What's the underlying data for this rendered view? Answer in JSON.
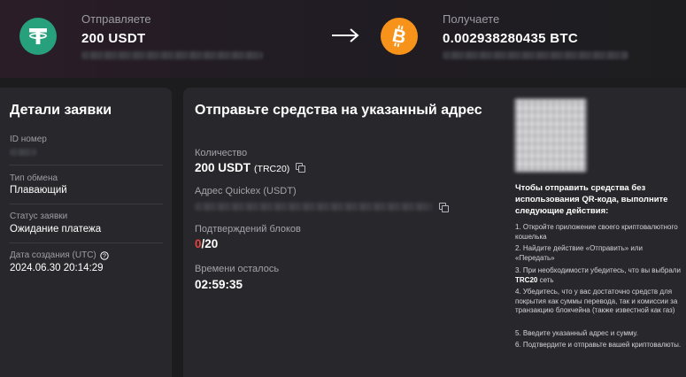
{
  "send": {
    "label": "Отправляете",
    "amount": "200  USDT",
    "coin_icon": "tether-icon",
    "color": "#26a17b"
  },
  "receive": {
    "label": "Получаете",
    "amount": "0.002938280435  BTC",
    "coin_icon": "bitcoin-icon",
    "color": "#f7931a"
  },
  "details": {
    "title": "Детали заявки",
    "fields": [
      {
        "label": "ID номер",
        "value": ""
      },
      {
        "label": "Тип обмена",
        "value": "Плавающий"
      },
      {
        "label": "Статус заявки",
        "value": "Ожидание платежа"
      },
      {
        "label": "Дата создания (UTC)",
        "value": "2024.06.30 20:14:29"
      }
    ]
  },
  "main": {
    "title": "Отправьте средства на указанный адрес",
    "quantity_label": "Количество",
    "quantity_value": "200 USDT",
    "quantity_network": "(TRC20)",
    "address_label": "Адрес Quickex (USDT)",
    "confirm_label": "Подтверждений блоков",
    "confirm_current": "0",
    "confirm_total": "/20",
    "time_label": "Времени осталось",
    "time_value": "02:59:35"
  },
  "instructions": {
    "title": "Чтобы отправить средства без использования QR-кода, выполните следующие действия:",
    "step1": "1. Откройте приложение своего криптовалютного кошелька",
    "step2": "2. Найдите действие «Отправить» или «Передать»",
    "step3_pre": "3. При необходимости убедитесь, что вы выбрали",
    "step3_bold": "TRC20",
    "step3_post": "сеть",
    "step4": "4. Убедитесь, что у вас достаточно средств для покрытия как суммы перевода, так и комиссии за транзакцию блокчейна (также известной как газ)",
    "step5": "5. Введите указанный адрес и сумму.",
    "step6": "6. Подтвердите и отправьте вашей криптовалюты."
  }
}
